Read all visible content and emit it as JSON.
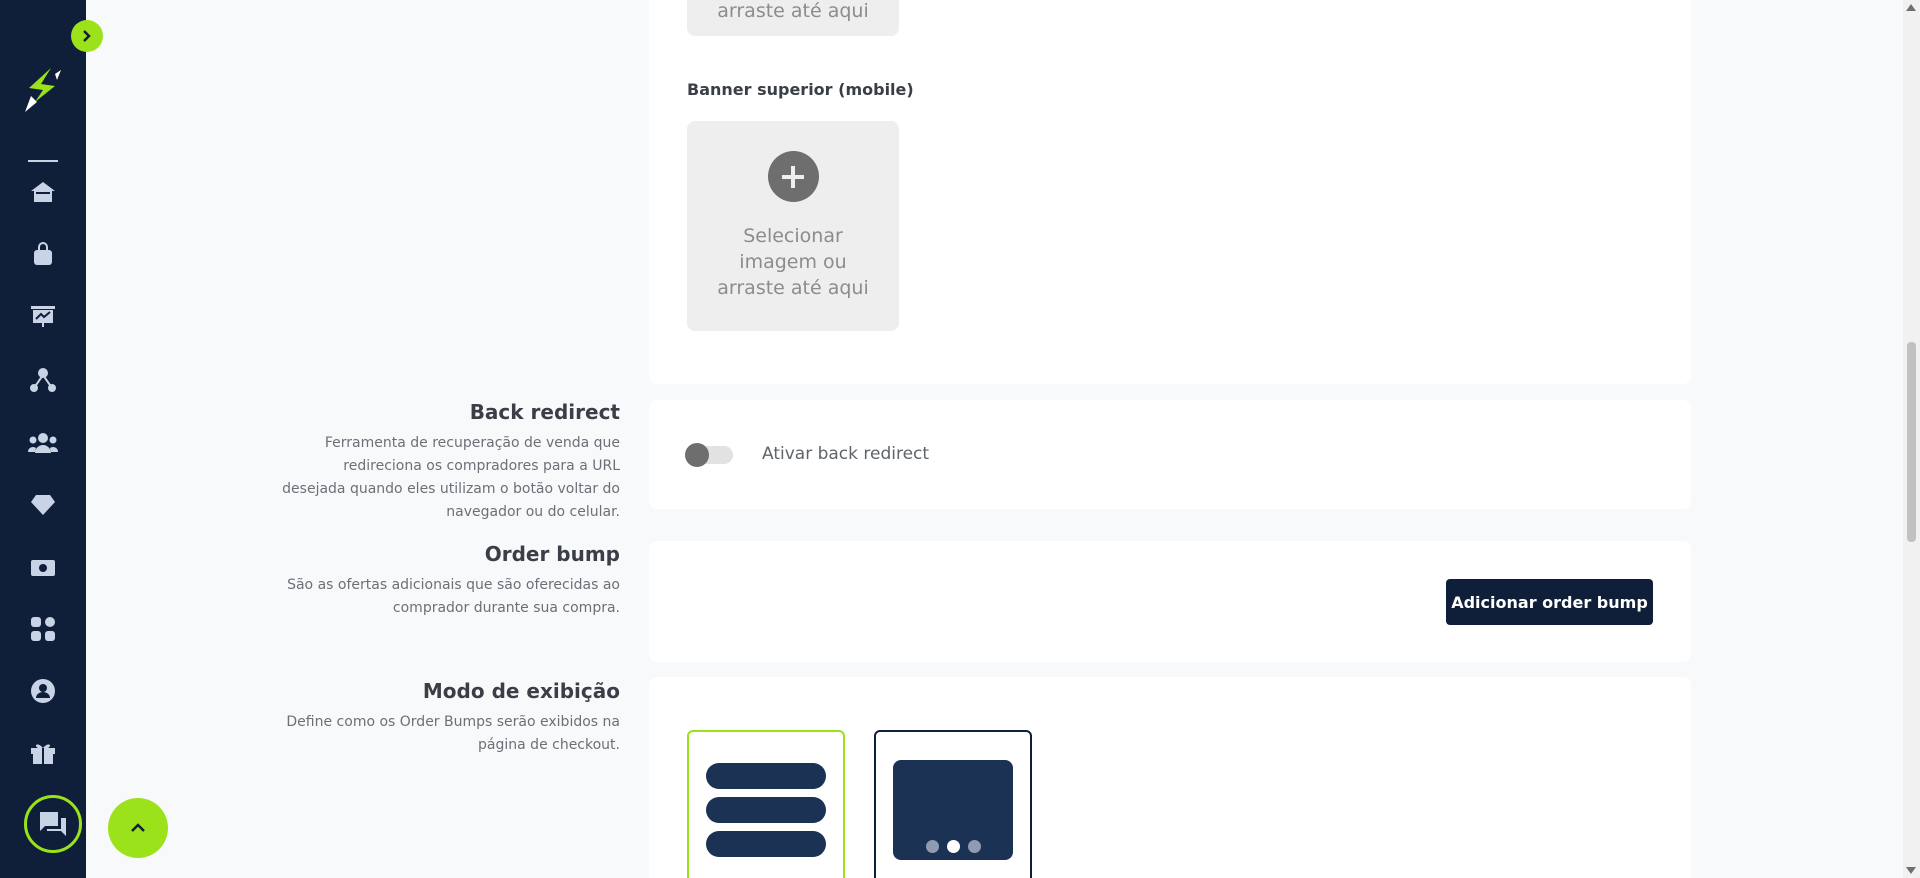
{
  "colors": {
    "sidebar": "#0f1f3a",
    "accent": "#9be21b",
    "primary_button": "#0f1f3a",
    "card": "#ffffff",
    "page": "#f8f9fa"
  },
  "sidebar": {
    "icons": [
      "home-icon",
      "shopping-bag-icon",
      "presentation-chart-icon",
      "affiliates-network-icon",
      "users-icon",
      "diamond-icon",
      "money-icon",
      "apps-icon",
      "user-circle-icon",
      "gift-icon"
    ]
  },
  "banner": {
    "top_upload_text": "arraste até aqui",
    "mobile_label": "Banner superior (mobile)",
    "upload_line1": "Selecionar",
    "upload_line2": "imagem ou",
    "upload_line3": "arraste até aqui"
  },
  "back_redirect": {
    "title": "Back redirect",
    "description": "Ferramenta de recuperação de venda que redireciona os compradores para a URL desejada quando eles utilizam o botão voltar do navegador ou do celular.",
    "toggle_label": "Ativar back redirect",
    "enabled": false
  },
  "order_bump": {
    "title": "Order bump",
    "description": "São as ofertas adicionais que são oferecidas ao comprador durante sua compra.",
    "add_button": "Adicionar order bump"
  },
  "display_mode": {
    "title": "Modo de exibição",
    "description": "Define como os Order Bumps serão exibidos na página de checkout.",
    "selected": "list"
  }
}
